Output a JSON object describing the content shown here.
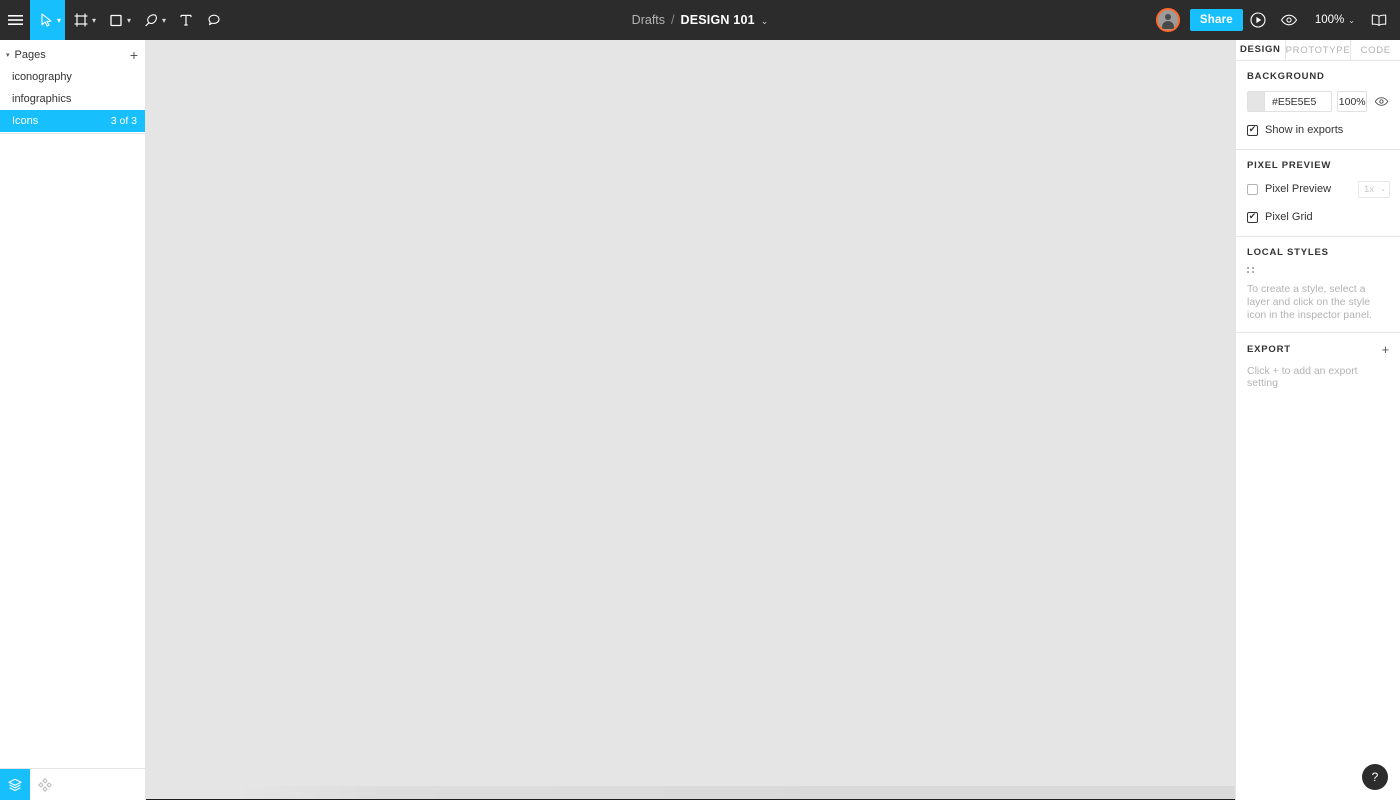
{
  "toolbar": {
    "menu_icon": "hamburger-menu-icon",
    "tools": [
      {
        "name": "move-tool",
        "icon": "cursor-arrow-icon",
        "has_chevron": true,
        "active": true
      },
      {
        "name": "frame-tool",
        "icon": "frame-icon",
        "has_chevron": true,
        "active": false
      },
      {
        "name": "shape-tool",
        "icon": "square-icon",
        "has_chevron": true,
        "active": false
      },
      {
        "name": "pen-tool",
        "icon": "pen-icon",
        "has_chevron": true,
        "active": false
      },
      {
        "name": "text-tool",
        "icon": "text-icon",
        "has_chevron": false,
        "active": false
      },
      {
        "name": "comment-tool",
        "icon": "comment-icon",
        "has_chevron": false,
        "active": false
      }
    ],
    "breadcrumb": {
      "parent": "Drafts",
      "separator": "/",
      "title": "DESIGN 101",
      "chevron": "⌄"
    },
    "avatar_label": "user-avatar",
    "share_label": "Share",
    "present_icon": "play-circle-icon",
    "view_icon": "eye-icon",
    "zoom_value": "100%",
    "zoom_chevron": "⌄",
    "library_icon": "book-icon",
    "accent_blue": "#18BFFD",
    "avatar_ring": "#FF6A2B",
    "bar_background": "#2C2C2C"
  },
  "left_panel": {
    "pages_header": {
      "caret": "▾",
      "label": "Pages",
      "add_label": "+"
    },
    "pages": [
      {
        "name": "iconography",
        "count": "",
        "selected": false
      },
      {
        "name": "infographics",
        "count": "",
        "selected": false
      },
      {
        "name": "Icons",
        "count": "3 of 3",
        "selected": true
      }
    ],
    "bottom_tabs": [
      {
        "name": "layers-tab",
        "icon": "layers-icon",
        "active": true
      },
      {
        "name": "components-tab",
        "icon": "components-diamond-icon",
        "active": false
      }
    ]
  },
  "canvas": {
    "background_color": "#E5E5E5"
  },
  "right_panel": {
    "tabs": [
      {
        "label": "DESIGN",
        "active": true
      },
      {
        "label": "PROTOTYPE",
        "active": false
      },
      {
        "label": "CODE",
        "active": false
      }
    ],
    "background": {
      "title": "BACKGROUND",
      "color_value": "#E5E5E5",
      "swatch_color": "#E5E5E5",
      "opacity": "100%",
      "visibility_icon": "eye-icon",
      "show_in_exports": {
        "label": "Show in exports",
        "checked": true
      }
    },
    "pixel_preview": {
      "title": "PIXEL PREVIEW",
      "pixel_preview": {
        "label": "Pixel Preview",
        "checked": false
      },
      "scale_value": "1x",
      "scale_chevron": "⌄",
      "pixel_grid": {
        "label": "Pixel Grid",
        "checked": true
      }
    },
    "local_styles": {
      "title": "LOCAL STYLES",
      "icon": "style-dots-icon",
      "hint": "To create a style, select a layer and click on the style icon in the inspector panel."
    },
    "export": {
      "title": "EXPORT",
      "add_label": "+",
      "hint": "Click + to add an export setting"
    }
  },
  "help": {
    "label": "?"
  }
}
